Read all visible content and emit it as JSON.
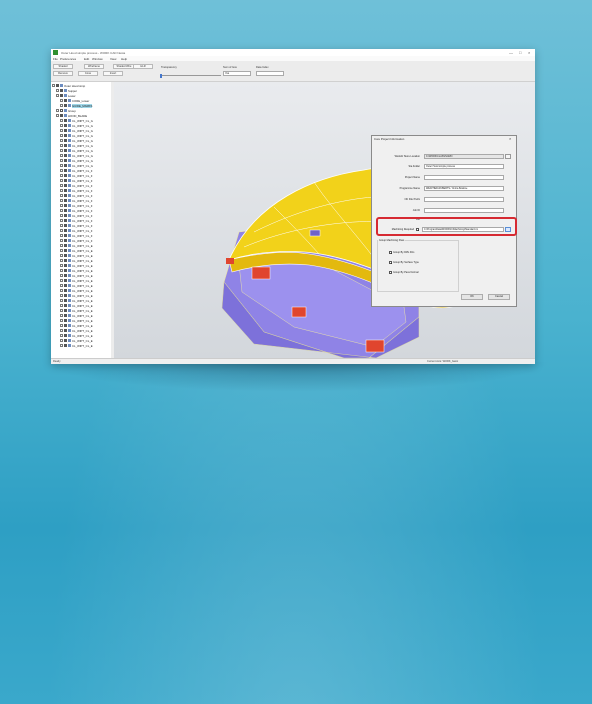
{
  "window": {
    "title": "Outer Hood simple process - WORK CAD Nesta",
    "controls": [
      "—",
      "□",
      "×"
    ]
  },
  "menu": [
    "File",
    "Preferences",
    "Edit",
    "Window",
    "View",
    "Help"
  ],
  "toolbar": {
    "row1_buttons": [
      "Shaded",
      "Wireframe",
      "Shaded Wire",
      "HLR"
    ],
    "row2_buttons": [
      "Remove",
      "Cone",
      "Invert"
    ],
    "transparency_label": "Transparency",
    "num_iso_label": "Num of Isos",
    "num_iso_value": "Yes",
    "data_index_label": "Data Index",
    "data_index_value": ""
  },
  "tree": {
    "items": [
      {
        "label": "Outer Hood simp",
        "depth": 0,
        "checked": true,
        "selected": false
      },
      {
        "label": "Supper",
        "depth": 1,
        "checked": true,
        "selected": false
      },
      {
        "label": "Lower",
        "depth": 1,
        "checked": true,
        "selected": false
      },
      {
        "label": "CORE_Lower",
        "depth": 2,
        "checked": true,
        "selected": false
      },
      {
        "label": "GUIDE_MARKS",
        "depth": 2,
        "checked": true,
        "selected": true
      },
      {
        "label": "Group",
        "depth": 1,
        "checked": false,
        "selected": false
      },
      {
        "label": "HOOD_BLADE",
        "depth": 1,
        "checked": true,
        "selected": false
      },
      {
        "label": "CL_WIPT_CL_G",
        "depth": 2,
        "checked": true,
        "selected": false
      },
      {
        "label": "CL_WIPT_CL_G",
        "depth": 2,
        "checked": true,
        "selected": false
      },
      {
        "label": "CL_WIPT_CL_G",
        "depth": 2,
        "checked": true,
        "selected": false
      },
      {
        "label": "CL_WIPT_CL_G",
        "depth": 2,
        "checked": true,
        "selected": false
      },
      {
        "label": "CL_WIPT_CL_G",
        "depth": 2,
        "checked": true,
        "selected": false
      },
      {
        "label": "CL_WIPT_CL_G",
        "depth": 2,
        "checked": true,
        "selected": false
      },
      {
        "label": "CL_WIPT_CL_G",
        "depth": 2,
        "checked": true,
        "selected": false
      },
      {
        "label": "CL_WIPT_CL_G",
        "depth": 2,
        "checked": true,
        "selected": false
      },
      {
        "label": "CL_WIPT_CL_G",
        "depth": 2,
        "checked": true,
        "selected": false
      },
      {
        "label": "CL_WIPT_CL_G",
        "depth": 2,
        "checked": true,
        "selected": false
      },
      {
        "label": "CL_WIPT_CL_F",
        "depth": 2,
        "checked": true,
        "selected": false
      },
      {
        "label": "CL_WIPT_CL_F",
        "depth": 2,
        "checked": true,
        "selected": false
      },
      {
        "label": "CL_WIPT_CL_F",
        "depth": 2,
        "checked": true,
        "selected": false
      },
      {
        "label": "CL_WIPT_CL_F",
        "depth": 2,
        "checked": true,
        "selected": false
      },
      {
        "label": "CL_WIPT_CL_F",
        "depth": 2,
        "checked": true,
        "selected": false
      },
      {
        "label": "CL_WIPT_CL_F",
        "depth": 2,
        "checked": true,
        "selected": false
      },
      {
        "label": "CL_WIPT_CL_F",
        "depth": 2,
        "checked": true,
        "selected": false
      },
      {
        "label": "CL_WIPT_CL_F",
        "depth": 2,
        "checked": true,
        "selected": false
      },
      {
        "label": "CL_WIPT_CL_F",
        "depth": 2,
        "checked": true,
        "selected": false
      },
      {
        "label": "CL_WIPT_CL_F",
        "depth": 2,
        "checked": true,
        "selected": false
      },
      {
        "label": "CL_WIPT_CL_F",
        "depth": 2,
        "checked": true,
        "selected": false
      },
      {
        "label": "CL_WIPT_CL_F",
        "depth": 2,
        "checked": true,
        "selected": false
      },
      {
        "label": "CL_WIPT_CL_F",
        "depth": 2,
        "checked": true,
        "selected": false
      },
      {
        "label": "CL_WIPT_CL_F",
        "depth": 2,
        "checked": true,
        "selected": false
      },
      {
        "label": "CL_WIPT_CL_F",
        "depth": 2,
        "checked": true,
        "selected": false
      },
      {
        "label": "CL_WIPT_CL_E",
        "depth": 2,
        "checked": true,
        "selected": false
      },
      {
        "label": "CL_WIPT_CL_E",
        "depth": 2,
        "checked": true,
        "selected": false
      },
      {
        "label": "CL_WIPT_CL_E",
        "depth": 2,
        "checked": true,
        "selected": false
      },
      {
        "label": "CL_WIPT_CL_E",
        "depth": 2,
        "checked": true,
        "selected": false
      },
      {
        "label": "CL_WIPT_CL_E",
        "depth": 2,
        "checked": true,
        "selected": false
      },
      {
        "label": "CL_WIPT_CL_E",
        "depth": 2,
        "checked": true,
        "selected": false
      },
      {
        "label": "CL_WIPT_CL_E",
        "depth": 2,
        "checked": true,
        "selected": false
      },
      {
        "label": "CL_WIPT_CL_E",
        "depth": 2,
        "checked": true,
        "selected": false
      },
      {
        "label": "CL_WIPT_CL_E",
        "depth": 2,
        "checked": true,
        "selected": false
      },
      {
        "label": "CL_WIPT_CL_E",
        "depth": 2,
        "checked": true,
        "selected": false
      },
      {
        "label": "CL_WIPT_CL_E",
        "depth": 2,
        "checked": true,
        "selected": false
      },
      {
        "label": "CL_WIPT_CL_E",
        "depth": 2,
        "checked": true,
        "selected": false
      },
      {
        "label": "CL_WIPT_CL_E",
        "depth": 2,
        "checked": true,
        "selected": false
      },
      {
        "label": "CL_WIPT_CL_E",
        "depth": 2,
        "checked": true,
        "selected": false
      },
      {
        "label": "CL_WIPT_CL_E",
        "depth": 2,
        "checked": true,
        "selected": false
      },
      {
        "label": "CL_WIPT_CL_E",
        "depth": 2,
        "checked": true,
        "selected": false
      },
      {
        "label": "CL_WIPT_CL_E",
        "depth": 2,
        "checked": true,
        "selected": false
      },
      {
        "label": "CL_WIPT_CL_E",
        "depth": 2,
        "checked": true,
        "selected": false
      },
      {
        "label": "CL_WIPT_CL_E",
        "depth": 2,
        "checked": true,
        "selected": false
      },
      {
        "label": "CL_WIPT_CL_E",
        "depth": 2,
        "checked": true,
        "selected": false
      },
      {
        "label": "CL_WIPT_CL_E",
        "depth": 2,
        "checked": true,
        "selected": false
      }
    ]
  },
  "status": {
    "left": "Ready",
    "right": "Current Axis: WORK_basic"
  },
  "dialog": {
    "title": "Core Project Information",
    "close": "×",
    "fields": [
      {
        "label": "Workdir Store Location",
        "value": "C:\\WORK\\CLASS\\VAMO",
        "readonly": true,
        "browse": true
      },
      {
        "label": "Sta Folder",
        "value": "Outer Hood simple process",
        "readonly": false,
        "browse": false
      },
      {
        "label": "Project Name",
        "value": "",
        "readonly": false,
        "browse": false
      },
      {
        "label": "Programme Name",
        "value": "WEATHER-RUBERTS / Cintra Bowline",
        "readonly": false,
        "browse": false
      },
      {
        "label": "NC File Prefix",
        "value": "",
        "readonly": false,
        "browse": false
      },
      {
        "label": "Job ID",
        "value": "",
        "readonly": false,
        "browse": false
      },
      {
        "label": "Job",
        "value": "",
        "readonly": false,
        "browse": false
      }
    ],
    "machining": {
      "label": "Machining Required",
      "value": "C:\\ProgramData\\WORKNC\\Machining\\Standard.ini",
      "checked": true
    },
    "group_title": "Group Machining Pass",
    "options": [
      {
        "label": "Group By Diffs Dirs",
        "checked": true
      },
      {
        "label": "Group By Surface Type",
        "checked": true
      },
      {
        "label": "Group By Pass Normal",
        "checked": false
      }
    ],
    "ok": "OK",
    "cancel": "Cancel"
  },
  "colors": {
    "background": "#4ab2cf",
    "part_yellow": "#f2d21a",
    "part_blue": "#8f83e6",
    "part_red": "#e0452e",
    "highlight_red": "#d62a32"
  },
  "icons": [
    "app-icon",
    "model-3d-view",
    "triad-axes-icon",
    "browse-folder-icon"
  ]
}
